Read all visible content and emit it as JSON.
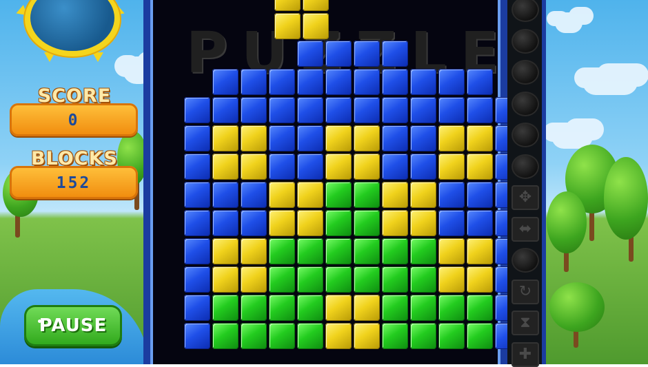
{
  "hud": {
    "score_label": "SCORE",
    "score_value": "0",
    "blocks_label": "BLOCKS",
    "blocks_value": "152",
    "pause_label": "PAUSE"
  },
  "board": {
    "watermark": "PUZZLE",
    "colors": {
      "b": "#1f4fe8",
      "y": "#f0d21c",
      "g": "#23cc1f"
    },
    "falling_piece": {
      "color": "y",
      "cells": [
        [
          0,
          5
        ],
        [
          0,
          6
        ],
        [
          1,
          5
        ],
        [
          1,
          6
        ]
      ]
    },
    "rows": [
      ".....bbbb....",
      "..bbbbbbbbbb.",
      ".bbbbbbbbbbbb",
      ".byybbyybbyyb",
      ".byybbyybbyyb",
      ".bbbyyggyybbb",
      ".bbbyyggyybbb",
      ".byyggggggyyb",
      ".byyggggggyyb",
      ".bggggyyggggb",
      ".bggggyyggggb"
    ]
  },
  "powerups": [
    {
      "name": "bomb",
      "icon": "bomb-icon"
    },
    {
      "name": "bomb",
      "icon": "bomb-icon"
    },
    {
      "name": "bomb",
      "icon": "bomb-icon"
    },
    {
      "name": "bomb",
      "icon": "bomb-icon"
    },
    {
      "name": "bomb",
      "icon": "bomb-icon"
    },
    {
      "name": "bomb",
      "icon": "bomb-icon"
    },
    {
      "name": "move",
      "icon": "move-arrows-icon"
    },
    {
      "name": "swap",
      "icon": "horizontal-arrows-icon"
    },
    {
      "name": "bomb",
      "icon": "bomb-icon"
    },
    {
      "name": "rotate",
      "icon": "rotate-icon"
    },
    {
      "name": "hourglass",
      "icon": "hourglass-icon"
    },
    {
      "name": "puzzle",
      "icon": "puzzle-piece-icon"
    }
  ]
}
